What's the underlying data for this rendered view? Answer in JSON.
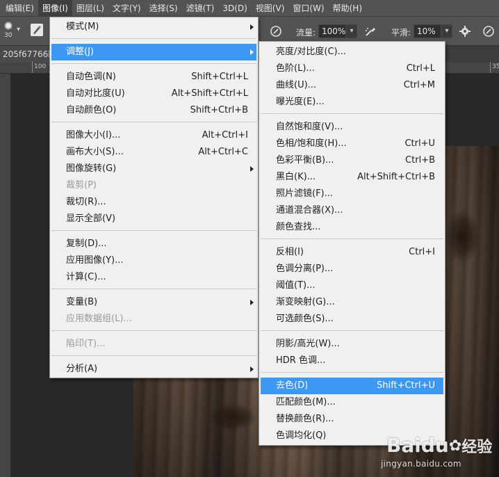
{
  "menubar": {
    "items": [
      {
        "label": "编辑(E)"
      },
      {
        "label": "图像(I)"
      },
      {
        "label": "图层(L)"
      },
      {
        "label": "文字(Y)"
      },
      {
        "label": "选择(S)"
      },
      {
        "label": "滤镜(T)"
      },
      {
        "label": "3D(D)"
      },
      {
        "label": "视图(V)"
      },
      {
        "label": "窗口(W)"
      },
      {
        "label": "帮助(H)"
      }
    ],
    "active_index": 1
  },
  "optbar": {
    "brush_size": "30",
    "flow_label": "流量:",
    "flow_value": "100%",
    "smoothing_label": "平滑:",
    "smoothing_value": "10%"
  },
  "document": {
    "tab_label": "205f67766b6",
    "ruler_left": "100",
    "ruler_right": "35"
  },
  "image_menu": {
    "items": [
      {
        "label": "模式(M)",
        "shortcut": "",
        "submenu": true
      },
      {
        "label": "调整(J)",
        "shortcut": "",
        "submenu": true,
        "highlighted": true
      },
      {
        "label": "自动色调(N)",
        "shortcut": "Shift+Ctrl+L"
      },
      {
        "label": "自动对比度(U)",
        "shortcut": "Alt+Shift+Ctrl+L"
      },
      {
        "label": "自动颜色(O)",
        "shortcut": "Shift+Ctrl+B"
      },
      {
        "label": "图像大小(I)...",
        "shortcut": "Alt+Ctrl+I"
      },
      {
        "label": "画布大小(S)...",
        "shortcut": "Alt+Ctrl+C"
      },
      {
        "label": "图像旋转(G)",
        "shortcut": "",
        "submenu": true
      },
      {
        "label": "裁剪(P)",
        "shortcut": "",
        "disabled": true
      },
      {
        "label": "裁切(R)...",
        "shortcut": ""
      },
      {
        "label": "显示全部(V)",
        "shortcut": ""
      },
      {
        "label": "复制(D)...",
        "shortcut": ""
      },
      {
        "label": "应用图像(Y)...",
        "shortcut": ""
      },
      {
        "label": "计算(C)...",
        "shortcut": ""
      },
      {
        "label": "变量(B)",
        "shortcut": "",
        "submenu": true
      },
      {
        "label": "应用数据组(L)...",
        "shortcut": "",
        "disabled": true
      },
      {
        "label": "陷印(T)...",
        "shortcut": "",
        "disabled": true
      },
      {
        "label": "分析(A)",
        "shortcut": "",
        "submenu": true
      }
    ]
  },
  "adjust_menu": {
    "items": [
      {
        "label": "亮度/对比度(C)...",
        "shortcut": ""
      },
      {
        "label": "色阶(L)...",
        "shortcut": "Ctrl+L"
      },
      {
        "label": "曲线(U)...",
        "shortcut": "Ctrl+M"
      },
      {
        "label": "曝光度(E)...",
        "shortcut": ""
      },
      {
        "label": "自然饱和度(V)...",
        "shortcut": ""
      },
      {
        "label": "色相/饱和度(H)...",
        "shortcut": "Ctrl+U"
      },
      {
        "label": "色彩平衡(B)...",
        "shortcut": "Ctrl+B"
      },
      {
        "label": "黑白(K)...",
        "shortcut": "Alt+Shift+Ctrl+B"
      },
      {
        "label": "照片滤镜(F)...",
        "shortcut": ""
      },
      {
        "label": "通道混合器(X)...",
        "shortcut": ""
      },
      {
        "label": "颜色查找...",
        "shortcut": ""
      },
      {
        "label": "反相(I)",
        "shortcut": "Ctrl+I"
      },
      {
        "label": "色调分离(P)...",
        "shortcut": ""
      },
      {
        "label": "阈值(T)...",
        "shortcut": ""
      },
      {
        "label": "渐变映射(G)...",
        "shortcut": ""
      },
      {
        "label": "可选颜色(S)...",
        "shortcut": ""
      },
      {
        "label": "阴影/高光(W)...",
        "shortcut": ""
      },
      {
        "label": "HDR 色调...",
        "shortcut": ""
      },
      {
        "label": "去色(D)",
        "shortcut": "Shift+Ctrl+U",
        "highlighted": true
      },
      {
        "label": "匹配颜色(M)...",
        "shortcut": ""
      },
      {
        "label": "替换颜色(R)...",
        "shortcut": ""
      },
      {
        "label": "色调均化(Q)",
        "shortcut": ""
      }
    ]
  },
  "watermark": {
    "logo_text": "Baidu",
    "logo_cn": "经验",
    "url": "jingyan.baidu.com"
  },
  "colors": {
    "menu_highlight": "#3c98f2",
    "menu_bg": "#f0f0f0",
    "ui_dark": "#535353"
  }
}
